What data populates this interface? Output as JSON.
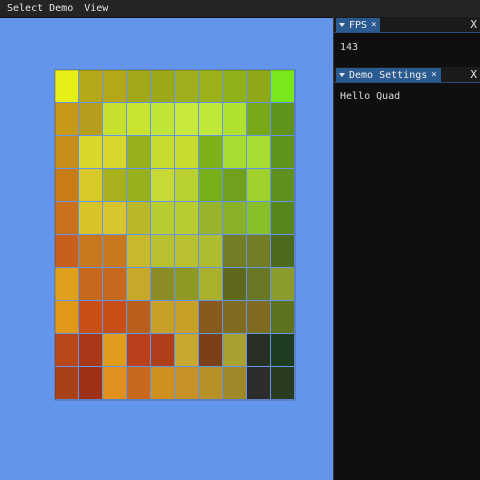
{
  "menubar": {
    "items": [
      "Select Demo",
      "View"
    ]
  },
  "viewport": {
    "background": "#6495ed",
    "grid": {
      "cols": 10,
      "rows": 10,
      "colors": [
        [
          "#e6f018",
          "#b4a818",
          "#b4a818",
          "#a0a818",
          "#9ca818",
          "#a0b01c",
          "#9cb018",
          "#90b018",
          "#90a818",
          "#78e81c"
        ],
        [
          "#c89818",
          "#b89c1c",
          "#c8e02c",
          "#c8e430",
          "#c0e438",
          "#c8e83c",
          "#c0e838",
          "#b0e030",
          "#78a818",
          "#60941c"
        ],
        [
          "#c88c18",
          "#d8d828",
          "#d8d82c",
          "#98b01c",
          "#c8dc30",
          "#c8dc30",
          "#80b018",
          "#a8dc30",
          "#a8dc30",
          "#60941c"
        ],
        [
          "#c87c18",
          "#d8c828",
          "#a8b01c",
          "#98b01c",
          "#c8d834",
          "#b8d030",
          "#78b01c",
          "#70a01c",
          "#a0d02c",
          "#609020"
        ],
        [
          "#c8701c",
          "#d8c428",
          "#d8c42c",
          "#b8b828",
          "#b8cc30",
          "#b8cc30",
          "#98b42c",
          "#88b028",
          "#88c02c",
          "#58861c"
        ],
        [
          "#c8601c",
          "#c8781c",
          "#c8781c",
          "#c8b82c",
          "#b8c030",
          "#b8c030",
          "#b0bc30",
          "#747c24",
          "#747c24",
          "#4c6a1c"
        ],
        [
          "#e0a01c",
          "#c8681c",
          "#c8681c",
          "#c8a828",
          "#8c8c24",
          "#909824",
          "#a8b02c",
          "#60681c",
          "#687824",
          "#8c9c2c"
        ],
        [
          "#e09818",
          "#c85018",
          "#c85018",
          "#b8601c",
          "#c8a028",
          "#c8a028",
          "#885a1c",
          "#806c20",
          "#806c20",
          "#5c721c"
        ],
        [
          "#b84818",
          "#a83818",
          "#e09c1c",
          "#b8401c",
          "#b0401c",
          "#c8a830",
          "#7c4018",
          "#a8a030",
          "#283024",
          "#203c20"
        ],
        [
          "#a84018",
          "#a03018",
          "#e0901c",
          "#c8681c",
          "#d09020",
          "#c89028",
          "#b89028",
          "#a08828",
          "#2c2c2c",
          "#283a20"
        ]
      ]
    }
  },
  "panels": {
    "fps": {
      "title": "FPS",
      "value": "143"
    },
    "demo_settings": {
      "title": "Demo Settings",
      "value": "Hello Quad"
    }
  },
  "icons": {
    "collapse": "▼",
    "close": "×",
    "close_x": "X"
  }
}
